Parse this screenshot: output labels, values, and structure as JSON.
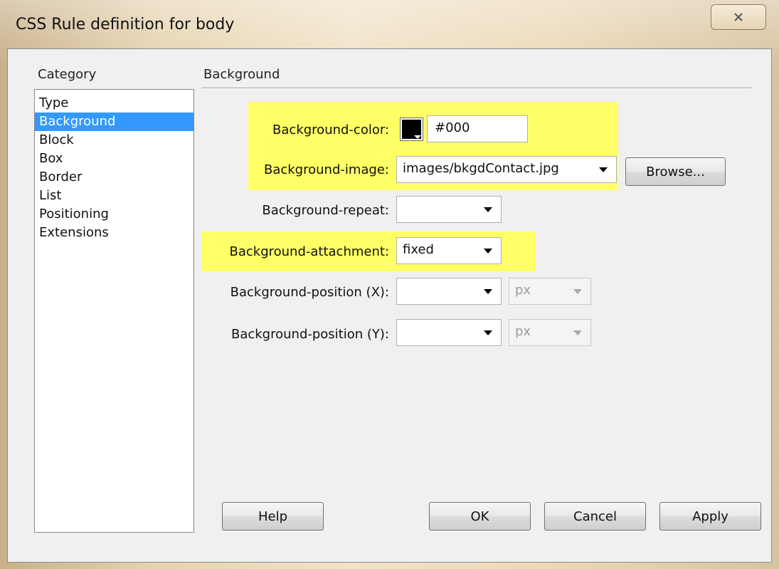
{
  "window": {
    "title": "CSS Rule definition for body",
    "close_icon": "close-x-icon"
  },
  "category": {
    "label": "Category",
    "items": [
      "Type",
      "Background",
      "Block",
      "Box",
      "Border",
      "List",
      "Positioning",
      "Extensions"
    ],
    "selected": "Background"
  },
  "section": {
    "title": "Background"
  },
  "fields": {
    "bg_color": {
      "label": "Background-color:",
      "value": "#000",
      "swatch_color": "#000000"
    },
    "bg_image": {
      "label": "Background-image:",
      "value": "images/bkgdContact.jpg"
    },
    "bg_repeat": {
      "label": "Background-repeat:",
      "value": ""
    },
    "bg_attachment": {
      "label": "Background-attachment:",
      "value": "fixed"
    },
    "bg_pos_x": {
      "label": "Background-position (X):",
      "value": "",
      "unit": "px"
    },
    "bg_pos_y": {
      "label": "Background-position (Y):",
      "value": "",
      "unit": "px"
    }
  },
  "buttons": {
    "browse": "Browse...",
    "help": "Help",
    "ok": "OK",
    "cancel": "Cancel",
    "apply": "Apply"
  },
  "highlight_color": "#ffff66"
}
